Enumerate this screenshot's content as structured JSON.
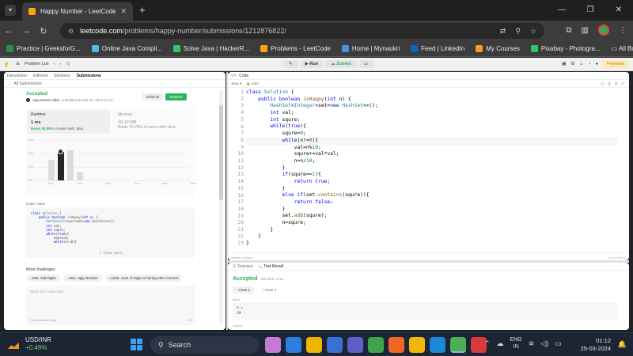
{
  "browser": {
    "tab_title": "Happy Number - LeetCode",
    "url_host": "leetcode.com",
    "url_path": "/problems/happy-number/submissions/1212876822/",
    "bookmarks": [
      {
        "label": "Practice | GeeksforG...",
        "color": "#2f8d46"
      },
      {
        "label": "Online Java Compil...",
        "color": "#5bd"
      },
      {
        "label": "Solve Java | HackerR...",
        "color": "#2ec866"
      },
      {
        "label": "Problems - LeetCode",
        "color": "#ffa116"
      },
      {
        "label": "Home | Mynaukri",
        "color": "#4a90e2"
      },
      {
        "label": "Feed | LinkedIn",
        "color": "#0a66c2"
      },
      {
        "label": "My Courses",
        "color": "#f0a020"
      },
      {
        "label": "Pixabay - Photogra...",
        "color": "#2ec66d"
      }
    ],
    "all_bookmarks": "All Bookmarks"
  },
  "lc": {
    "problem_list": "Problem List",
    "run": "Run",
    "submit": "Submit",
    "premium": "Premium",
    "tabs": [
      "Description",
      "Editorial",
      "Solutions",
      "Submissions"
    ],
    "all_submissions": "All Submissions",
    "status": "Accepted",
    "author": "Ajay Kumar Ojha",
    "submitted": "submitted at Mar 25, 2024 01:17",
    "editorial_btn": "Editorial",
    "solution_btn": "Solution",
    "runtime_label": "Runtime",
    "runtime_value": "1 ms",
    "runtime_beats": "Beats 84.85%",
    "runtime_beats_suffix": "of users with Java",
    "memory_label": "Memory",
    "memory_value": "40.12 MB",
    "memory_beats": "Beats 76.78% of users with Java",
    "code_header": "Code  |  Java",
    "view_more": "View more",
    "more_challenges": "More challenges",
    "challenges": [
      "258. Add Digits",
      "263. Ugly Number",
      "1945. Sum of Digits of String After Convert"
    ],
    "notes_placeholder": "Write your notes here",
    "notes_footer": "Select related tags",
    "notes_count": "0/5",
    "code_tab": "Code",
    "lang_select": "Java",
    "auto": "Auto",
    "saved": "Saved to cloud",
    "cursor": "Ln 8, Col 21",
    "result_tabs": [
      "Testcase",
      "Test Result"
    ],
    "result_status": "Accepted",
    "result_runtime": "Runtime: 0 ms",
    "cases": [
      "Case 1",
      "Case 2"
    ],
    "input_label": "Input",
    "input_name": "n =",
    "input_value": "19",
    "output_label": "Output"
  },
  "preview_code": [
    "class Solution {",
    "    public boolean isHappy(int n) {",
    "        HashSet<Integer>set=new HashSet<>();",
    "        int val;",
    "        int squre;",
    "        while(true){",
    "            squre=0;",
    "            while(n!=0){"
  ],
  "chart_data": {
    "type": "bar",
    "x": [
      "0ms",
      "1ms",
      "2ms",
      "3ms",
      "4ms",
      "5ms"
    ],
    "y_ticks": [
      "60%",
      "40%",
      "20%",
      "0%"
    ]
  },
  "code": [
    "class Solution {",
    "    public boolean isHappy(int n) {",
    "        HashSet<Integer>set=new HashSet<>();",
    "        int val;",
    "        int squre;",
    "        while(true){",
    "            squre=0;",
    "            while(n!=0){",
    "                val=n%10;",
    "                squre+=val*val;",
    "                n=n/10;",
    "            }",
    "            if(squre==1){",
    "                return true;",
    "            }",
    "            else if(set.contains(squre)){",
    "                return false;",
    "            }",
    "            set.add(squre);",
    "            n=squre;",
    "        }",
    "    }",
    "}"
  ],
  "taskbar": {
    "ticker": "USD/INR",
    "change": "+0.49%",
    "search": "Search",
    "lang1": "ENG",
    "lang2": "IN",
    "time": "01:12",
    "date": "25-03-2024"
  }
}
